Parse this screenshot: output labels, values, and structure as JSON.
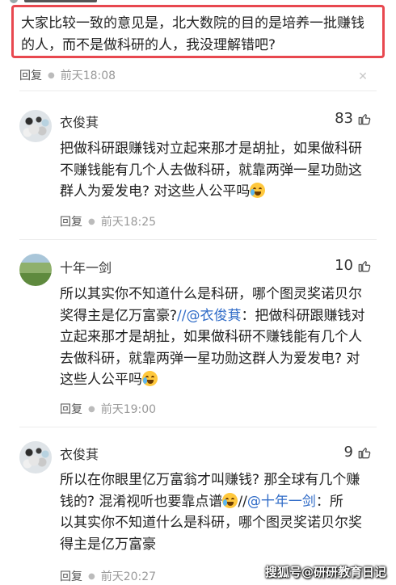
{
  "quoted_comment": {
    "line1": "大家比较一致的意见是，北大数院的目的是培养一批赚钱",
    "line2": "的人，而不是做科研的人，我没理解错吧?",
    "reply_label": "回复",
    "time": "前天18:08"
  },
  "comments": [
    {
      "username": "衣俊萁",
      "likes": "83",
      "text_lines": [
        "把做科研跟赚钱对立起来那才是胡扯，如果做科研",
        "不赚钱能有几个人去做科研，就靠两弹一星功勋这",
        "群人为爱发电? 对这些人公平吗"
      ],
      "reply_label": "回复",
      "time": "前天18:25"
    },
    {
      "username": "十年一剑",
      "likes": "10",
      "text_lines": [
        "所以其实你不知道什么是科研，哪个图灵奖诺贝尔",
        "奖得主是亿万富豪?",
        "//@衣俊萁",
        "：把做科研跟赚钱对",
        "立起来那才是胡扯，如果做科研不赚钱能有几个人",
        "去做科研，就靠两弹一星功勋这群人为爱发电? 对",
        "这些人公平吗"
      ],
      "reply_label": "回复",
      "time": "前天19:00"
    },
    {
      "username": "衣俊萁",
      "likes": "9",
      "text_lines": [
        "所以在你眼里亿万富翁才叫赚钱? 那全球有几个赚",
        "钱的? 混淆视听也要靠点谱",
        "//",
        "@十年一剑",
        "：所",
        "以其实你不知道什么是科研，哪个图灵奖诺贝尔奖",
        "得主是亿万富豪"
      ],
      "reply_label": "回复",
      "time": "前天20:27"
    }
  ],
  "icons": {
    "close": "close-icon",
    "thumb": "thumb-up-icon",
    "emoji": "crying-laughing-emoji"
  },
  "watermark": "搜狐号@研研教育日记",
  "colors": {
    "highlight_border": "#e8484f",
    "mention": "#2f6bc7"
  }
}
